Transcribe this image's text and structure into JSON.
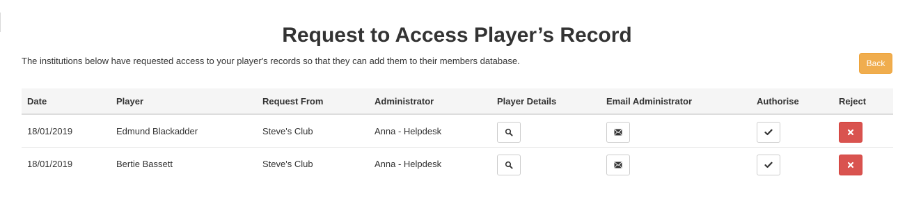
{
  "page": {
    "title": "Request to Access Player’s Record",
    "intro": "The institutions below have requested access to your player's records so that they can add them to their members database.",
    "back_label": "Back"
  },
  "table": {
    "columns": [
      "Date",
      "Player",
      "Request From",
      "Administrator",
      "Player Details",
      "Email Administrator",
      "Authorise",
      "Reject"
    ],
    "rows": [
      {
        "date": "18/01/2019",
        "player": "Edmund Blackadder",
        "request_from": "Steve's Club",
        "administrator": "Anna - Helpdesk"
      },
      {
        "date": "18/01/2019",
        "player": "Bertie Bassett",
        "request_from": "Steve's Club",
        "administrator": "Anna - Helpdesk"
      }
    ]
  },
  "icons": {
    "player_details": "search-icon",
    "email_administrator": "envelope-icon",
    "authorise": "check-icon",
    "reject": "close-icon"
  },
  "colors": {
    "back_button": "#f0ad4e",
    "reject_button": "#d9534f",
    "header_row_bg": "#f5f5f5"
  }
}
